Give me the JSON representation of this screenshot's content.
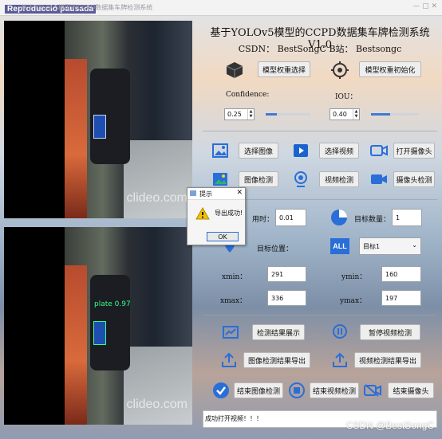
{
  "window": {
    "badge": "Reproducció pausada",
    "title": "基于YOLOv5模型的CCPD数据集车牌检测系统",
    "controls": "—  ▢  ✕"
  },
  "video": {
    "watermark_top": "clideo.com",
    "watermark_bottom": "clideo.com",
    "detection_label": "plate 0.97"
  },
  "header": {
    "title": "基于YOLOv5模型的CCPD数据集车牌检测系统V1.0",
    "subtitle": "CSDN：  BestSongC    B站：  Bestsongc"
  },
  "model": {
    "select_weights": "模型权重选择",
    "init_weights": "模型权重初始化"
  },
  "params": {
    "confidence_label": "Confidence:",
    "confidence_value": "0.25",
    "confidence_level": 0.25,
    "iou_label": "IOU：",
    "iou_value": "0.40",
    "iou_level": 0.4
  },
  "actions": {
    "select_image": "选择图像",
    "select_video": "选择视频",
    "open_camera": "打开摄像头",
    "detect_image": "图像检测",
    "detect_video": "视频检测",
    "detect_camera": "摄像头检测"
  },
  "results": {
    "time_label": "用时：",
    "time_value": "0.01",
    "count_label": "目标数量：",
    "count_value": "1",
    "position_label": "目标位置：",
    "target_select": "目标1",
    "xmin_label": "xmin：",
    "xmin_value": "291",
    "ymin_label": "ymin：",
    "ymin_value": "160",
    "xmax_label": "xmax：",
    "xmax_value": "336",
    "ymax_label": "ymax：",
    "ymax_value": "197",
    "all_icon_text": "ALL"
  },
  "controls": {
    "show_results": "检测结果展示",
    "pause_video": "暂停视频检测",
    "export_image": "图像检测结果导出",
    "export_video": "视频检测结果导出",
    "end_image": "结束图像检测",
    "end_video": "结束视频检测",
    "end_camera": "结束摄像头"
  },
  "status": {
    "message": "成功打开视频！！！"
  },
  "dialog": {
    "title": "提示",
    "message": "导出成功!",
    "ok": "OK"
  },
  "footer": {
    "watermark": "CSDN @BestSongC"
  },
  "colors": {
    "accent_blue": "#2a6ed8",
    "dialog_warning": "#f2c200"
  }
}
